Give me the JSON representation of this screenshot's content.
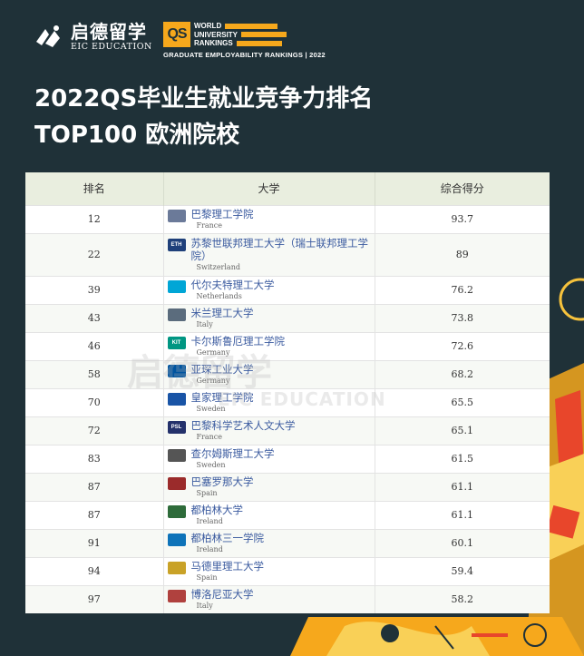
{
  "brand": {
    "eic_cn": "启德留学",
    "eic_en": "EIC EDUCATION"
  },
  "qs": {
    "mark": "QS",
    "line1": "WORLD",
    "line2": "UNIVERSITY",
    "line3": "RANKINGS",
    "subtitle": "GRADUATE EMPLOYABILITY RANKINGS | 2022"
  },
  "title": {
    "line1": "2022QS毕业生就业竞争力排名",
    "line2": "TOP100 欧洲院校"
  },
  "table": {
    "headers": [
      "排名",
      "大学",
      "综合得分"
    ],
    "rows": [
      {
        "rank": "12",
        "name": "巴黎理工学院",
        "country": "France",
        "score": "93.7",
        "crest": "logo-paris-polytech",
        "crest_color": "#6b7a99",
        "crest_text": ""
      },
      {
        "rank": "22",
        "name": "苏黎世联邦理工大学（瑞士联邦理工学院）",
        "country": "Switzerland",
        "score": "89",
        "crest": "logo-eth",
        "crest_color": "#1f407a",
        "crest_text": "ETH"
      },
      {
        "rank": "39",
        "name": "代尔夫特理工大学",
        "country": "Netherlands",
        "score": "76.2",
        "crest": "logo-tu-delft",
        "crest_color": "#00a6d6",
        "crest_text": ""
      },
      {
        "rank": "43",
        "name": "米兰理工大学",
        "country": "Italy",
        "score": "73.8",
        "crest": "logo-polimi",
        "crest_color": "#5b6c7d",
        "crest_text": ""
      },
      {
        "rank": "46",
        "name": "卡尔斯鲁厄理工学院",
        "country": "Germany",
        "score": "72.6",
        "crest": "logo-kit",
        "crest_color": "#009682",
        "crest_text": "KIT"
      },
      {
        "rank": "58",
        "name": "亚琛工业大学",
        "country": "Germany",
        "score": "68.2",
        "crest": "logo-rwth",
        "crest_color": "#00549f",
        "crest_text": ""
      },
      {
        "rank": "70",
        "name": "皇家理工学院",
        "country": "Sweden",
        "score": "65.5",
        "crest": "logo-kth",
        "crest_color": "#1954a6",
        "crest_text": ""
      },
      {
        "rank": "72",
        "name": "巴黎科学艺术人文大学",
        "country": "France",
        "score": "65.1",
        "crest": "logo-psl",
        "crest_color": "#24316b",
        "crest_text": "PSL"
      },
      {
        "rank": "83",
        "name": "查尔姆斯理工大学",
        "country": "Sweden",
        "score": "61.5",
        "crest": "logo-chalmers",
        "crest_color": "#555555",
        "crest_text": ""
      },
      {
        "rank": "87",
        "name": "巴塞罗那大学",
        "country": "Spain",
        "score": "61.1",
        "crest": "logo-barcelona",
        "crest_color": "#9b2b2b",
        "crest_text": ""
      },
      {
        "rank": "87",
        "name": "都柏林大学",
        "country": "Ireland",
        "score": "61.1",
        "crest": "logo-ucd",
        "crest_color": "#2e6b3a",
        "crest_text": ""
      },
      {
        "rank": "91",
        "name": "都柏林三一学院",
        "country": "Ireland",
        "score": "60.1",
        "crest": "logo-trinity",
        "crest_color": "#0e73b9",
        "crest_text": ""
      },
      {
        "rank": "94",
        "name": "马德里理工大学",
        "country": "Spain",
        "score": "59.4",
        "crest": "logo-upm",
        "crest_color": "#c9a227",
        "crest_text": ""
      },
      {
        "rank": "97",
        "name": "博洛尼亚大学",
        "country": "Italy",
        "score": "58.2",
        "crest": "logo-bologna",
        "crest_color": "#b0413e",
        "crest_text": ""
      }
    ]
  },
  "watermark": {
    "cn": "启德留学",
    "en": "EIC EDUCATION"
  },
  "colors": {
    "background": "#1f3138",
    "accent": "#f6a81c",
    "header_row": "#e9eedf",
    "link": "#3a5a9f"
  }
}
